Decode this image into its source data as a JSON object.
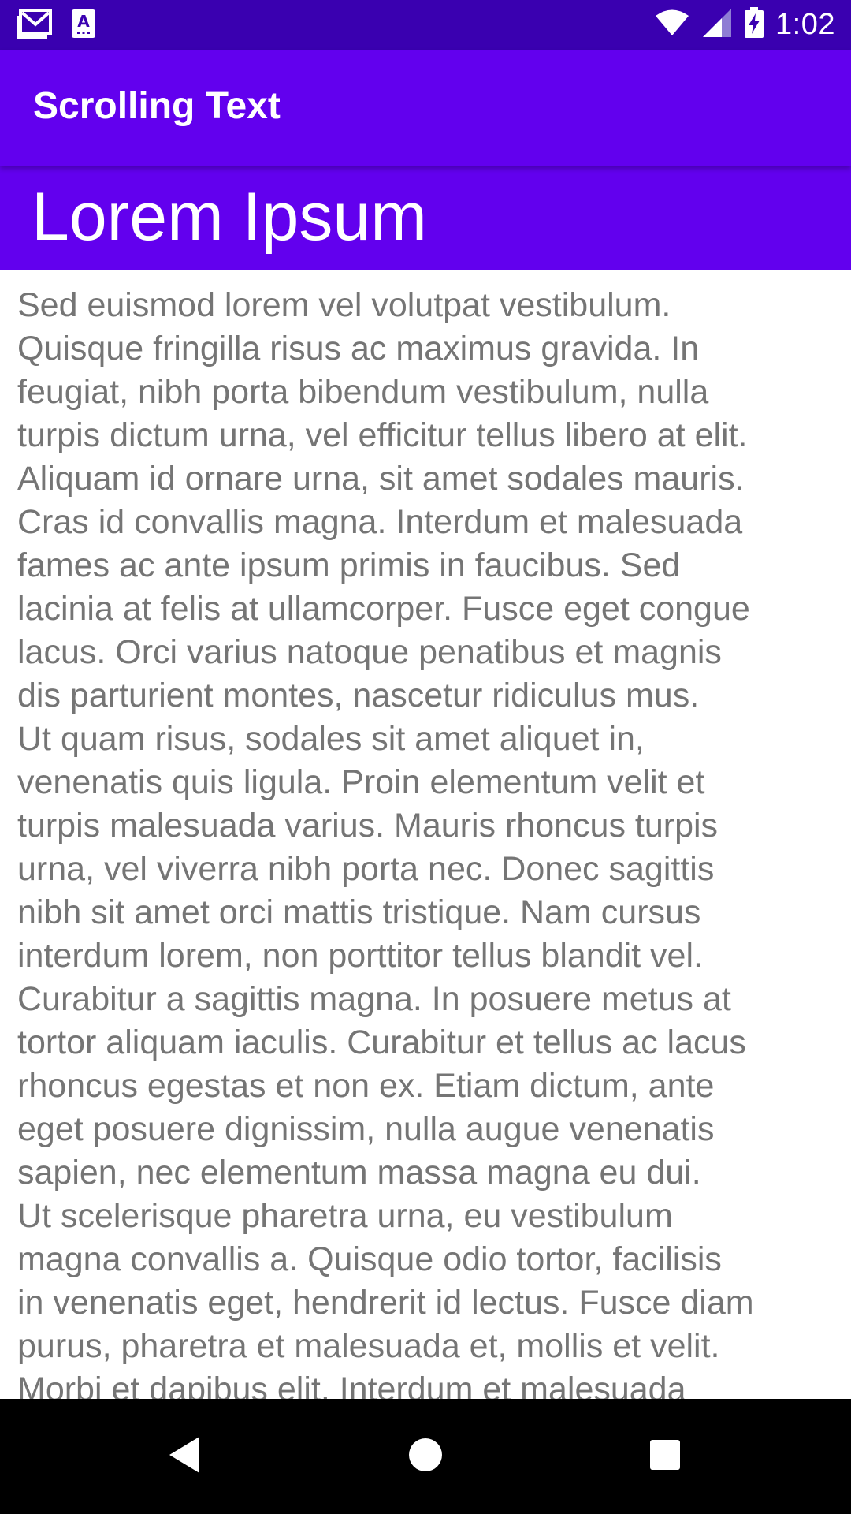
{
  "status_bar": {
    "time": "1:02",
    "left_icons": [
      "gmail-icon",
      "font-app-icon"
    ],
    "right_icons": [
      "wifi-icon",
      "cell-signal-icon",
      "battery-charging-icon"
    ]
  },
  "app_bar": {
    "title": "Scrolling Text"
  },
  "article": {
    "heading": "Lorem Ipsum",
    "body": "Sed euismod lorem vel volutpat vestibulum.\nQuisque fringilla risus ac maximus gravida. In\nfeugiat, nibh porta bibendum vestibulum, nulla\nturpis dictum urna, vel efficitur tellus libero at elit.\nAliquam id ornare urna, sit amet sodales mauris.\nCras id convallis magna. Interdum et malesuada\nfames ac ante ipsum primis in faucibus. Sed\nlacinia at felis at ullamcorper. Fusce eget congue\nlacus. Orci varius natoque penatibus et magnis\ndis parturient montes, nascetur ridiculus mus.\nUt quam risus, sodales sit amet aliquet in,\nvenenatis quis ligula. Proin elementum velit et\nturpis malesuada varius. Mauris rhoncus turpis\nurna, vel viverra nibh porta nec. Donec sagittis\nnibh sit amet orci mattis tristique. Nam cursus\ninterdum lorem, non porttitor tellus blandit vel.\nCurabitur a sagittis magna. In posuere metus at\ntortor aliquam iaculis. Curabitur et tellus ac lacus\nrhoncus egestas et non ex. Etiam dictum, ante\neget posuere dignissim, nulla augue venenatis\nsapien, nec elementum massa magna eu dui.\nUt scelerisque pharetra urna, eu vestibulum\nmagna convallis a. Quisque odio tortor, facilisis\nin venenatis eget, hendrerit id lectus. Fusce diam\npurus, pharetra et malesuada et, mollis et velit.\nMorbi et dapibus elit. Interdum et malesuada"
  },
  "nav_bar": {
    "buttons": [
      "back-icon",
      "home-icon",
      "recents-icon"
    ]
  },
  "colors": {
    "status_bar": "#3a00b0",
    "primary": "#6200ee",
    "body_text": "#757575",
    "background": "#ffffff",
    "nav_bar": "#000000"
  }
}
